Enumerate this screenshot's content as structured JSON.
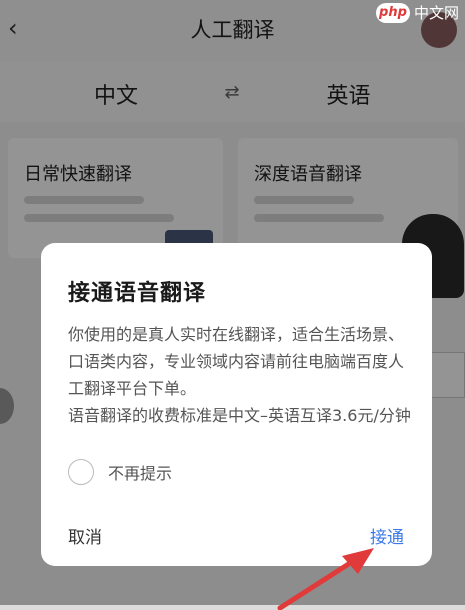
{
  "app": {
    "title": "人工翻译",
    "source_language": "中文",
    "target_language": "英语",
    "card_left_title": "日常快速翻译",
    "card_right_title": "深度语音翻译"
  },
  "watermark": {
    "logo": "php",
    "text": "中文网"
  },
  "dialog": {
    "title": "接通语音翻译",
    "body_paragraph_1": "你使用的是真人实时在线翻译，适合生活场景、口语类内容，专业领域内容请前往电脑端百度人工翻译平台下单。",
    "body_paragraph_2": "语音翻译的收费标准是中文–英语互译3.6元/分钟",
    "checkbox_label": "不再提示",
    "cancel_label": "取消",
    "confirm_label": "接通"
  },
  "colors": {
    "accent": "#3b79e8",
    "annotation_arrow": "#e03a3a"
  }
}
